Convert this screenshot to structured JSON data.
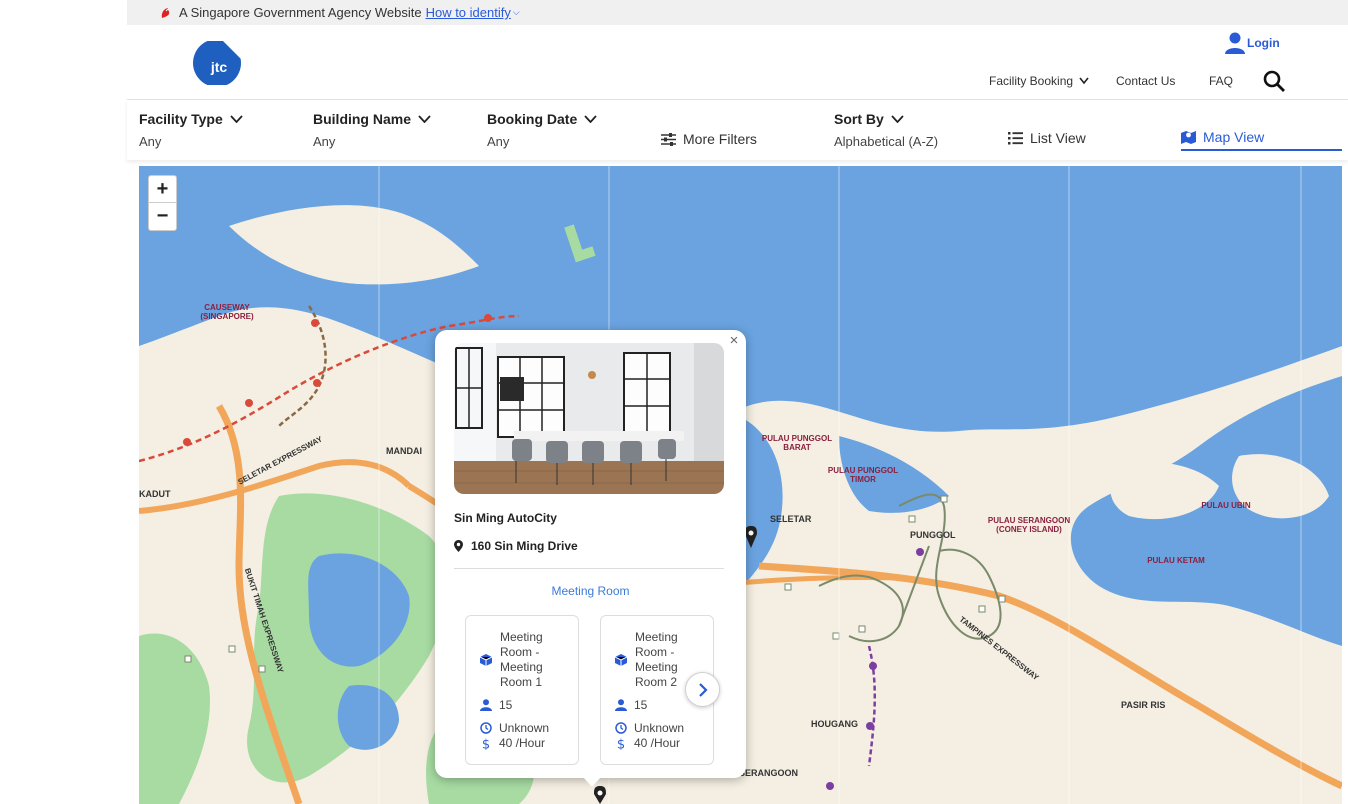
{
  "masthead": {
    "text": "A Singapore Government Agency Website",
    "link": "How to identify"
  },
  "header": {
    "logo_text": "jtc",
    "login": "Login",
    "nav": {
      "facility_booking": "Facility Booking",
      "contact_us": "Contact Us",
      "faq": "FAQ"
    }
  },
  "filters": {
    "facility_type": {
      "label": "Facility Type",
      "value": "Any"
    },
    "building_name": {
      "label": "Building Name",
      "value": "Any"
    },
    "booking_date": {
      "label": "Booking Date",
      "value": "Any"
    },
    "more_filters": "More Filters",
    "sort_by": {
      "label": "Sort By",
      "value": "Alphabetical (A-Z)"
    },
    "list_view": "List View",
    "map_view": "Map View"
  },
  "map": {
    "zoom_in": "+",
    "zoom_out": "−",
    "labels": {
      "causeway": "CAUSEWAY (SINGAPORE)",
      "mandai": "MANDAI",
      "kadut": "KADUT",
      "seletar_expressway": "SELETAR EXPRESSWAY",
      "bukit_timah": "BUKIT TIMAH EXPRESSWAY",
      "pulau_punggol_barat": "PULAU PUNGGOL BARAT",
      "pulau_punggol_timor": "PULAU PUNGGOL TIMOR",
      "seletar": "SELETAR",
      "punggol": "PUNGGOL",
      "pulau_serangoon": "PULAU SERANGOON (CONEY ISLAND)",
      "pulau_ubin": "PULAU UBIN",
      "pulau_ketam": "PULAU KETAM",
      "tampines_expressway": "TAMPINES EXPRESSWAY",
      "hougang": "HOUGANG",
      "pasir_ris": "PASIR RIS",
      "serangoon": "SERANGOON"
    }
  },
  "popup": {
    "close": "×",
    "title": "Sin Ming AutoCity",
    "address": "160 Sin Ming Drive",
    "category": "Meeting Room",
    "rooms": [
      {
        "name": "Meeting Room - Meeting Room 1",
        "capacity": "15",
        "status": "Unknown",
        "price": "40  /Hour"
      },
      {
        "name": "Meeting Room - Meeting Room 2",
        "capacity": "15",
        "status": "Unknown",
        "price": "40  /Hour"
      }
    ]
  },
  "colors": {
    "accent": "#2a5bd7",
    "water": "#6aa3e0",
    "land": "#f4efe2",
    "park": "#a7dba2",
    "expressway": "#f2a65a"
  }
}
